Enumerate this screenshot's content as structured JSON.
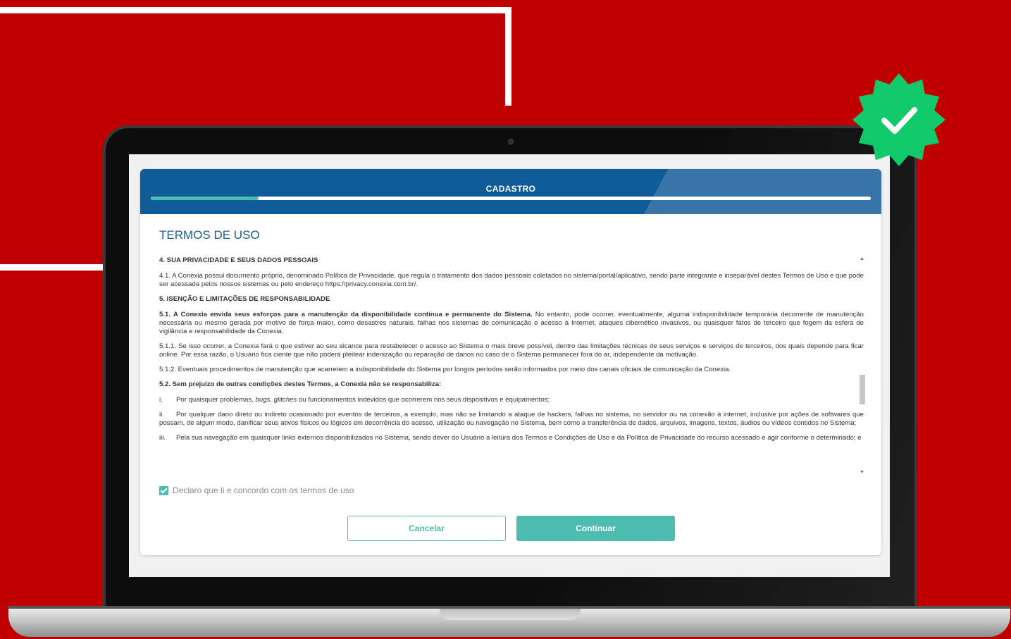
{
  "colors": {
    "background": "#c00000",
    "header": "#0f5c99",
    "accent": "#4dbdaf",
    "title": "#1d5c8e",
    "badge": "#12c96a"
  },
  "header": {
    "title": "CADASTRO",
    "progress_fraction": 0.15
  },
  "page_title": "TERMOS DE USO",
  "terms": {
    "sec4_heading": "4.   SUA PRIVACIDADE E SEUS DADOS PESSOAIS",
    "p41": "4.1.   A Conexia possui documento próprio, denominado Política de Privacidade, que regula o tratamento dos dados pessoais coletados no sistema/portal/aplicativo, sendo parte integrante e inseparável destes Termos de Uso e que pode ser acessada pelos nossos sistemas ou pelo endereço https://privacy.conexia.com.br/.",
    "sec5_heading": "5.   ISENÇÃO E LIMITAÇÕES DE RESPONSABILIDADE",
    "p51_bold": "5.1.    A Conexia envida seus esforços para a manutenção da disponibilidade contínua e permanente do Sistema.",
    "p51_rest": " No entanto, pode ocorrer, eventualmente, alguma indisponibilidade temporária decorrente de manutenção necessária ou mesmo gerada por motivo de força maior, como desastres naturais, falhas nos sistemas de comunicação e acesso à Internet, ataques cibernético invasivos, ou quaisquer fatos de terceiro que fogem da esfera de vigilância e responsabilidade da Conexia.",
    "p511": "5.1.1.  Se isso ocorrer, a Conexia fará o que estiver ao seu alcance para restabelecer o acesso ao Sistema o mais breve possível, dentro das limitações técnicas de seus serviços e serviços de terceiros, dos quais depende para ficar online. Por essa razão, o Usuário fica ciente que não poderá pleitear indenização ou reparação de danos no caso de o Sistema permanecer fora do ar, independente da motivação.",
    "p512": "5.1.2.  Eventuais procedimentos de manutenção que acarretem a indisponibilidade do Sistema por longos períodos serão informados por meio dos canais oficiais de comunicação da Conexia.",
    "p52": "5.2.    Sem prejuízo de outras condições destes Termos, a Conexia não se responsabiliza:",
    "item_i_num": "i.",
    "item_i_a": "Por quaisquer problemas, ",
    "item_i_b": "bugs, glitches",
    "item_i_c": " ou funcionamentos indevidos que ocorrerem nos seus dispositivos e equipamentos;",
    "item_ii_num": "ii.",
    "item_ii": "Por qualquer dano direto ou indireto ocasionado por eventos de terceiros, a exemplo, mas não se limitando a ataque de hackers, falhas no sistema, no servidor ou na conexão à internet, inclusive por ações de softwares que possam, de algum modo, danificar seus ativos físicos ou lógicos em decorrência do acesso, utilização ou navegação no Sistema, bem como a transferência de dados, arquivos, imagens, textos, áudios ou vídeos contidos no Sistema;",
    "item_iii_num": "iii.",
    "item_iii": "Pela sua navegação em quaisquer links externos disponibilizados no Sistema, sendo dever do Usuário a leitura dos Termos e Condições de Uso e da Política de Privacidade do recurso acessado e agir conforme o determinado; e"
  },
  "agreement": {
    "label": "Declaro que li e concordo com os termos de uso",
    "checked": true
  },
  "buttons": {
    "cancel": "Cancelar",
    "continue": "Continuar"
  }
}
